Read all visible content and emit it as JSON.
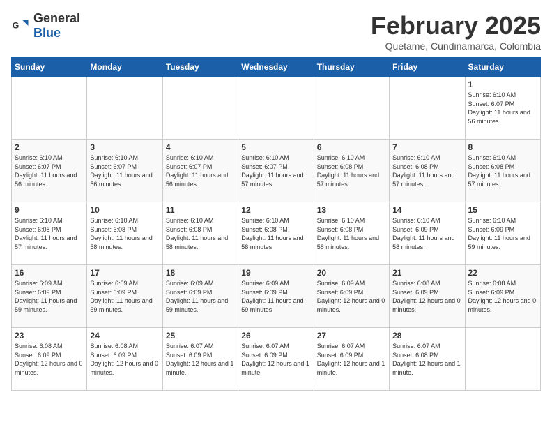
{
  "header": {
    "logo_general": "General",
    "logo_blue": "Blue",
    "month_year": "February 2025",
    "location": "Quetame, Cundinamarca, Colombia"
  },
  "days_of_week": [
    "Sunday",
    "Monday",
    "Tuesday",
    "Wednesday",
    "Thursday",
    "Friday",
    "Saturday"
  ],
  "weeks": [
    [
      {
        "day": "",
        "info": ""
      },
      {
        "day": "",
        "info": ""
      },
      {
        "day": "",
        "info": ""
      },
      {
        "day": "",
        "info": ""
      },
      {
        "day": "",
        "info": ""
      },
      {
        "day": "",
        "info": ""
      },
      {
        "day": "1",
        "info": "Sunrise: 6:10 AM\nSunset: 6:07 PM\nDaylight: 11 hours\nand 56 minutes."
      }
    ],
    [
      {
        "day": "2",
        "info": "Sunrise: 6:10 AM\nSunset: 6:07 PM\nDaylight: 11 hours\nand 56 minutes."
      },
      {
        "day": "3",
        "info": "Sunrise: 6:10 AM\nSunset: 6:07 PM\nDaylight: 11 hours\nand 56 minutes."
      },
      {
        "day": "4",
        "info": "Sunrise: 6:10 AM\nSunset: 6:07 PM\nDaylight: 11 hours\nand 56 minutes."
      },
      {
        "day": "5",
        "info": "Sunrise: 6:10 AM\nSunset: 6:07 PM\nDaylight: 11 hours\nand 57 minutes."
      },
      {
        "day": "6",
        "info": "Sunrise: 6:10 AM\nSunset: 6:08 PM\nDaylight: 11 hours\nand 57 minutes."
      },
      {
        "day": "7",
        "info": "Sunrise: 6:10 AM\nSunset: 6:08 PM\nDaylight: 11 hours\nand 57 minutes."
      },
      {
        "day": "8",
        "info": "Sunrise: 6:10 AM\nSunset: 6:08 PM\nDaylight: 11 hours\nand 57 minutes."
      }
    ],
    [
      {
        "day": "9",
        "info": "Sunrise: 6:10 AM\nSunset: 6:08 PM\nDaylight: 11 hours\nand 57 minutes."
      },
      {
        "day": "10",
        "info": "Sunrise: 6:10 AM\nSunset: 6:08 PM\nDaylight: 11 hours\nand 58 minutes."
      },
      {
        "day": "11",
        "info": "Sunrise: 6:10 AM\nSunset: 6:08 PM\nDaylight: 11 hours\nand 58 minutes."
      },
      {
        "day": "12",
        "info": "Sunrise: 6:10 AM\nSunset: 6:08 PM\nDaylight: 11 hours\nand 58 minutes."
      },
      {
        "day": "13",
        "info": "Sunrise: 6:10 AM\nSunset: 6:08 PM\nDaylight: 11 hours\nand 58 minutes."
      },
      {
        "day": "14",
        "info": "Sunrise: 6:10 AM\nSunset: 6:09 PM\nDaylight: 11 hours\nand 58 minutes."
      },
      {
        "day": "15",
        "info": "Sunrise: 6:10 AM\nSunset: 6:09 PM\nDaylight: 11 hours\nand 59 minutes."
      }
    ],
    [
      {
        "day": "16",
        "info": "Sunrise: 6:09 AM\nSunset: 6:09 PM\nDaylight: 11 hours\nand 59 minutes."
      },
      {
        "day": "17",
        "info": "Sunrise: 6:09 AM\nSunset: 6:09 PM\nDaylight: 11 hours\nand 59 minutes."
      },
      {
        "day": "18",
        "info": "Sunrise: 6:09 AM\nSunset: 6:09 PM\nDaylight: 11 hours\nand 59 minutes."
      },
      {
        "day": "19",
        "info": "Sunrise: 6:09 AM\nSunset: 6:09 PM\nDaylight: 11 hours\nand 59 minutes."
      },
      {
        "day": "20",
        "info": "Sunrise: 6:09 AM\nSunset: 6:09 PM\nDaylight: 12 hours\nand 0 minutes."
      },
      {
        "day": "21",
        "info": "Sunrise: 6:08 AM\nSunset: 6:09 PM\nDaylight: 12 hours\nand 0 minutes."
      },
      {
        "day": "22",
        "info": "Sunrise: 6:08 AM\nSunset: 6:09 PM\nDaylight: 12 hours\nand 0 minutes."
      }
    ],
    [
      {
        "day": "23",
        "info": "Sunrise: 6:08 AM\nSunset: 6:09 PM\nDaylight: 12 hours\nand 0 minutes."
      },
      {
        "day": "24",
        "info": "Sunrise: 6:08 AM\nSunset: 6:09 PM\nDaylight: 12 hours\nand 0 minutes."
      },
      {
        "day": "25",
        "info": "Sunrise: 6:07 AM\nSunset: 6:09 PM\nDaylight: 12 hours\nand 1 minute."
      },
      {
        "day": "26",
        "info": "Sunrise: 6:07 AM\nSunset: 6:09 PM\nDaylight: 12 hours\nand 1 minute."
      },
      {
        "day": "27",
        "info": "Sunrise: 6:07 AM\nSunset: 6:09 PM\nDaylight: 12 hours\nand 1 minute."
      },
      {
        "day": "28",
        "info": "Sunrise: 6:07 AM\nSunset: 6:08 PM\nDaylight: 12 hours\nand 1 minute."
      },
      {
        "day": "",
        "info": ""
      }
    ]
  ]
}
